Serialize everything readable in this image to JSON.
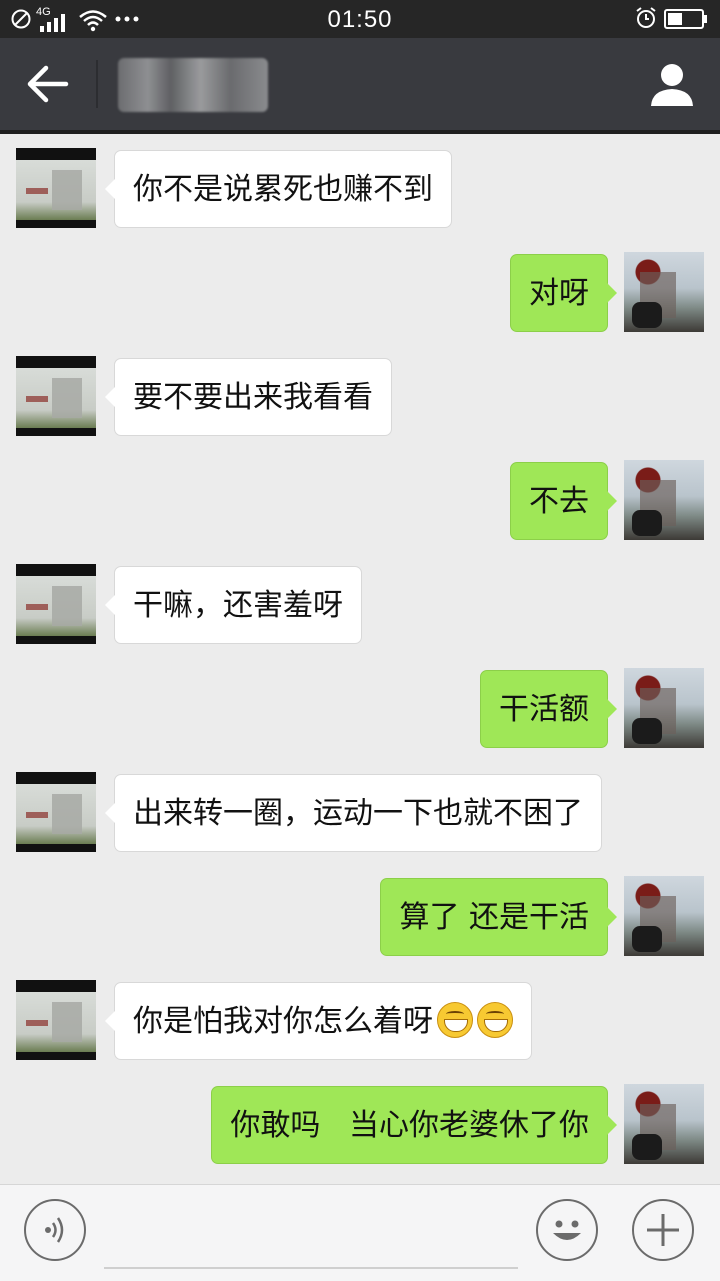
{
  "status_bar": {
    "time": "01:50",
    "network_label": "4G",
    "icons": [
      "dnd-icon",
      "signal-icon",
      "wifi-icon",
      "more-dots-icon",
      "alarm-icon",
      "battery-icon"
    ]
  },
  "title_bar": {
    "contact_name": "",
    "back_icon": "back-arrow-icon",
    "profile_icon": "profile-icon"
  },
  "messages": [
    {
      "side": "left",
      "text": "你不是说累死也赚不到"
    },
    {
      "side": "right",
      "text": "对呀"
    },
    {
      "side": "left",
      "text": "要不要出来我看看"
    },
    {
      "side": "right",
      "text": "不去"
    },
    {
      "side": "left",
      "text": "干嘛，还害羞呀"
    },
    {
      "side": "right",
      "text": "干活额"
    },
    {
      "side": "left",
      "text": "出来转一圈，运动一下也就不困了"
    },
    {
      "side": "right",
      "text": "算了  还是干活"
    },
    {
      "side": "left",
      "text": "你是怕我对你怎么着呀",
      "emojis": 2
    },
    {
      "side": "right",
      "text": "你敢吗   当心你老婆休了你"
    }
  ],
  "input_bar": {
    "value": "",
    "icons": [
      "voice-icon",
      "emoji-icon",
      "plus-icon"
    ]
  },
  "colors": {
    "status_bar": "#262626",
    "title_bar": "#393a3f",
    "chat_background": "#ececec",
    "sent_bubble": "#9fe757",
    "received_bubble": "#ffffff"
  }
}
